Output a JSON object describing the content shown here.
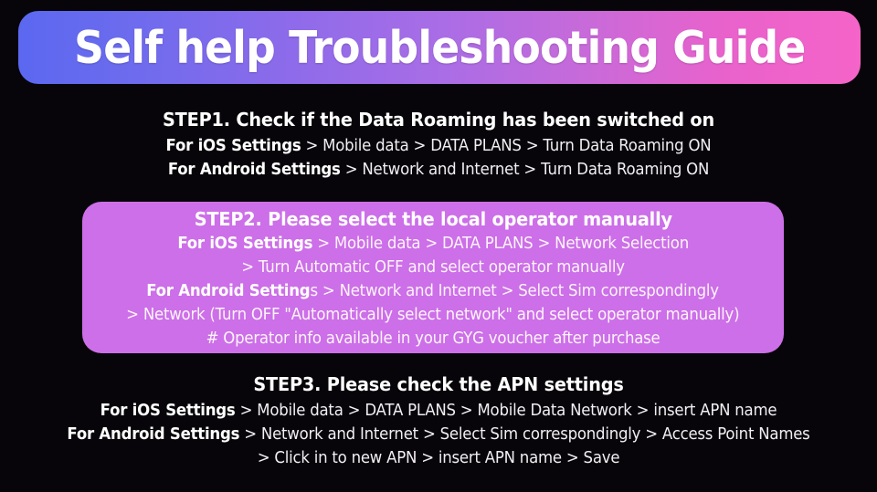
{
  "banner": {
    "title": "Self help Troubleshooting Guide",
    "gradient_from": "#5B68F0",
    "gradient_mid": "#9B6DE8",
    "gradient_to": "#F564C8"
  },
  "theme": {
    "background": "#070509",
    "text": "#FFFFFF",
    "highlight_card": "#CC6FE8"
  },
  "steps": [
    {
      "id": "step1",
      "heading": "STEP1. Check if the Data Roaming has been switched on",
      "lines": [
        {
          "lead": "For iOS Settings",
          "rest": " > Mobile data > DATA PLANS > Turn Data Roaming ON"
        },
        {
          "lead": "For Android Settings",
          "rest": " > Network and Internet > Turn Data Roaming ON"
        }
      ]
    },
    {
      "id": "step2",
      "heading": "STEP2. Please select the local operator manually",
      "lines": [
        {
          "lead": "For iOS Settings",
          "rest": " > Mobile data > DATA PLANS > Network Selection"
        },
        {
          "lead": "",
          "rest": "> Turn Automatic OFF and select operator manually"
        },
        {
          "lead": "For Android Setting",
          "lead_tail": "s",
          "rest": " > Network and Internet > Select Sim correspondingly"
        },
        {
          "lead": "",
          "rest": "> Network (Turn OFF \"Automatically select network\" and select operator manually)"
        },
        {
          "lead": "",
          "rest": "# Operator info available in your GYG voucher after purchase"
        }
      ]
    },
    {
      "id": "step3",
      "heading": "STEP3. Please check the APN settings",
      "lines": [
        {
          "lead": "For iOS Settings",
          "rest": " > Mobile data > DATA PLANS > Mobile Data Network > insert APN name"
        },
        {
          "lead": "For Android Settings",
          "rest": " > Network and Internet > Select Sim correspondingly > Access Point Names"
        },
        {
          "lead": "",
          "rest": "> Click in to new APN > insert APN name > Save"
        }
      ]
    }
  ]
}
